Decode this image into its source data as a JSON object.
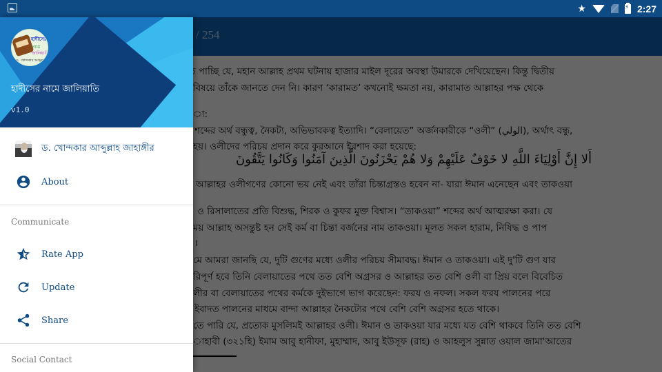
{
  "status_bar": {
    "left_icon": "gallery-icon",
    "icons": [
      "star-icon",
      "wifi-icon",
      "no-sim-icon",
      "battery-charging-icon"
    ],
    "time": "2:27"
  },
  "app_bar": {
    "page_count": "/ 254"
  },
  "content": {
    "lines": [
      "তে পাচ্ছি যে, মহান আল্লাহ প্রথম ঘটনায় হাজার মাইল দূরের অবস্থা উমারকে দেখিয়েছেন। কিন্তু দ্বিতীয়",
      "র বিষয়ে তাঁকে জানতে দেন নি। কারণ ‘কারামত’ কখনোই ক্ষমতা নয়, কারামাত আল্লাহর পক্ষ থেকে",
      "া:",
      "শব্দের অর্থ বন্ধুত্ব, নৈকট্য, অভিভাবকত্ব ইত্যাদি। “বেলায়েত” অর্জনকারীকে “ওলী” (الولي), অর্থাৎ বন্ধু,",
      "হয়। ওলীদের পরিচয় প্রদান করে কুরআনে ইরশাদ করা হয়েছে:",
      "আল্লাহর ওলীগণের কোনো ভয় নেই এবং তাঁরা চিন্তাগ্রস্তও হবেন না- যারা ঈমান এনেছেন এবং তাকওয়া",
      "ও রিসালাতের প্রতি বিশুদ্ধ, শিরক ও কুফর মুক্ত বিশ্বাস। “তাকওয়া” শব্দের অর্থ আত্মরক্ষা করা। যে",
      "ময় আল্লাহ অসন্তুষ্ট হন সেই কর্ম বা চিন্তা বর্জনের নাম তাকওয়া। মূলত সকল হারাম, নিষিদ্ধ ও পাপ",
      "।",
      "মে আমরা জানছি যে, দুটি গুণের মধ্যে ওলীর পরিচয় সীমাবদ্ধ। ঈমান ও তাকওয়া। এই দু'টি গুণ যার",
      "রিপূর্ণ হবে তিনি বেলায়াতের পথে তত বেশি অগ্রসর ও আল্লাহর তত বেশি ওলী বা প্রিয় বলে বিবেচিত",
      "লীর বা বেলায়াতের পথের কর্মকে দুইভাগে ভাগ করেছেন: ফরয ও নফল। সকল ফরয পালনের পরে",
      "ইবাদত পালনের মাধমে বান্দা আল্লাহর নৈকট্যের পথে বেশি বেশি অগ্রসর হতে থাকে।",
      "তে পারি যে, প্রত্যেক মুসলিমই আল্লাহর ওলী। ঈমান ও তাকওয়া যার মধ্যে যত বেশি থাকবে তিনি তত বেশি",
      "াহাবী (৩২১হি) ইমাম আবু হানীফা, মুহাম্মাদ, আবু ইউসূফ (রাহ)  ও আহলুস সুন্নাত ওয়াল জামা'আতের"
    ],
    "arabic_verse": "أَلا إِنَّ أَوْلِيَاءَ اللَّهِ لا خَوْفٌ عَلَيْهِمْ وَلا هُمْ يَحْزَنُونَ الَّذِينَ آمَنُوا وَكَانُوا يَتَّقُونَ"
  },
  "drawer": {
    "header": {
      "logo_text": [
        "হাদীসের",
        "নামে",
        "জালিয়াতি",
        "ড. খোন্দকার আব্দুল্লাহ"
      ],
      "title": "হাদীসের নামে জালিয়াতি",
      "version": "v1.0"
    },
    "items_top": [
      {
        "label": "ড. খোন্দকার আব্দুল্লাহ জাহাঙ্গীর",
        "icon": "author-photo"
      },
      {
        "label": "About",
        "icon": "account-circle-icon"
      }
    ],
    "section_communicate": "Communicate",
    "items_communicate": [
      {
        "label": "Rate App",
        "icon": "star-half-icon"
      },
      {
        "label": "Update",
        "icon": "refresh-icon"
      },
      {
        "label": "Share",
        "icon": "share-icon"
      }
    ],
    "section_social": "Social Contact"
  },
  "colors": {
    "primary_dark": "#0e4a84",
    "primary": "#0f5ea8",
    "header_light": "#2aa3e0",
    "drawer_text": "#0e4a84"
  }
}
